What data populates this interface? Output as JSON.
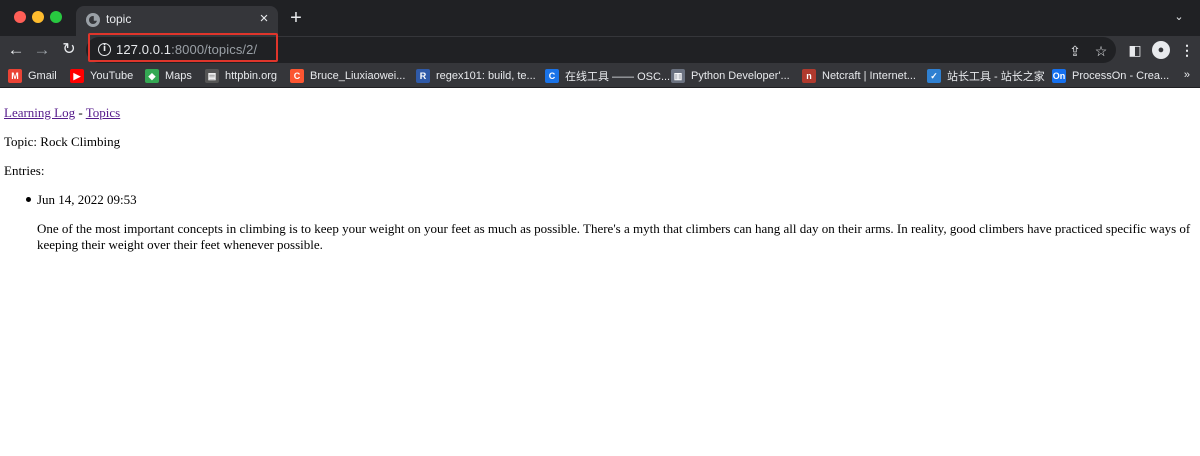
{
  "browser": {
    "tab": {
      "title": "topic"
    },
    "address": {
      "host": "127.0.0.1",
      "rest": ":8000/topics/2/"
    },
    "bookmarks": [
      {
        "label": "Gmail",
        "icon": "gmail-icon",
        "color": "#ea4335",
        "glyph": "M"
      },
      {
        "label": "YouTube",
        "icon": "youtube-icon",
        "color": "#ff0000",
        "glyph": "▶"
      },
      {
        "label": "Maps",
        "icon": "maps-icon",
        "color": "#34a853",
        "glyph": "◆"
      },
      {
        "label": "httpbin.org",
        "icon": "httpbin-icon",
        "color": "#555555",
        "glyph": "▤"
      },
      {
        "label": "Bruce_Liuxiaowei...",
        "icon": "csdn-icon",
        "color": "#fc5531",
        "glyph": "C"
      },
      {
        "label": "regex101: build, te...",
        "icon": "regex101-icon",
        "color": "#2f5aa8",
        "glyph": "R"
      },
      {
        "label": "在线工具 —— OSC...",
        "icon": "oschina-icon",
        "color": "#1a73e8",
        "glyph": "C"
      },
      {
        "label": "Python Developer'...",
        "icon": "python-icon",
        "color": "#6b7280",
        "glyph": "▥"
      },
      {
        "label": "Netcraft | Internet...",
        "icon": "netcraft-icon",
        "color": "#b03a2e",
        "glyph": "n"
      },
      {
        "label": "站长工具 - 站长之家",
        "icon": "chinaz-icon",
        "color": "#2f80d1",
        "glyph": "✓"
      },
      {
        "label": "ProcessOn - Crea...",
        "icon": "processon-icon",
        "color": "#1570ef",
        "glyph": "On"
      }
    ],
    "bookmarks_more": "»"
  },
  "page": {
    "nav": {
      "home_link": "Learning Log",
      "separator": "-",
      "topics_link": "Topics"
    },
    "topic_heading": "Topic: Rock Climbing",
    "entries_label": "Entries:",
    "entries": [
      {
        "date": "Jun 14, 2022 09:53",
        "text": "One of the most important concepts in climbing is to keep your weight on your feet as much as possible. There's a myth that climbers can hang all day on their arms. In reality, good climbers have practiced specific ways of keeping their weight over their feet whenever possible."
      }
    ]
  }
}
